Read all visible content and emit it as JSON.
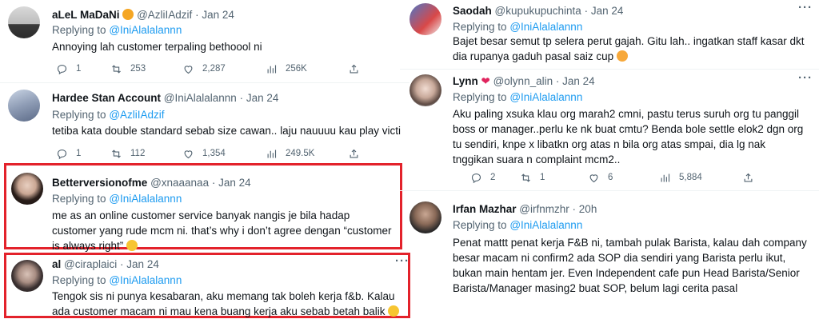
{
  "left": {
    "tweets": [
      {
        "name": "aLeL MaDaNi",
        "handle": "@AzliIAdzif",
        "date": "Jan 24",
        "reply_prefix": "Replying to",
        "reply_to": "@IniAlalalannn",
        "text": "Annoying lah customer terpaling bethoool ni",
        "stats": {
          "replies": "1",
          "retweets": "253",
          "likes": "2,287",
          "views": "256K"
        }
      },
      {
        "name": "Hardee Stan Account",
        "handle": "@IniAlalalannn",
        "date": "Jan 24",
        "reply_prefix": "Replying to",
        "reply_to": "@AzliIAdzif",
        "text": "tetiba kata double standard sebab size cawan.. laju nauuuu kau play victi",
        "stats": {
          "replies": "1",
          "retweets": "112",
          "likes": "1,354",
          "views": "249.5K"
        }
      },
      {
        "name": "Betterversionofme",
        "handle": "@xnaaanaa",
        "date": "Jan 24",
        "reply_prefix": "Replying to",
        "reply_to": "@IniAlalalannn",
        "text": "me as an online customer service banyak nangis je bila hadap customer yang rude mcm ni. that’s why i don’t agree dengan “customer is always right”"
      },
      {
        "name": "al",
        "handle": "@ciraplaici",
        "date": "Jan 24",
        "reply_prefix": "Replying to",
        "reply_to": "@IniAlalalannn",
        "text": "Tengok sis ni punya kesabaran, aku memang tak boleh kerja f&b. Kalau ada customer macam ni mau kena buang kerja aku sebab betah balik"
      }
    ]
  },
  "right": {
    "tweets": [
      {
        "name": "Saodah",
        "handle": "@kupukupuchinta",
        "date": "Jan 24",
        "reply_prefix": "Replying to",
        "reply_to": "@IniAlalalannn",
        "text": "Bajet besar semut tp selera perut gajah. Gitu lah.. ingatkan staff kasar dkt dia rupanya gaduh pasal saiz cup"
      },
      {
        "name": "Lynn",
        "handle": "@olynn_alin",
        "date": "Jan 24",
        "reply_prefix": "Replying to",
        "reply_to": "@IniAlalalannn",
        "text": "Aku paling xsuka klau org marah2 cmni, pastu terus suruh org tu panggil boss or manager..perlu ke nk buat cmtu? Benda bole settle elok2 dgn org tu sendiri, knpe x libatkn org atas n bila org atas smpai, dia lg nak tnggikan suara n complaint mcm2..",
        "stats": {
          "replies": "2",
          "retweets": "1",
          "likes": "6",
          "views": "5,884"
        }
      },
      {
        "name": "Irfan Mazhar",
        "handle": "@irfnmzhr",
        "date": "20h",
        "reply_prefix": "Replying to",
        "reply_to": "@IniAlalalannn",
        "text": "Penat mattt penat kerja F&B ni, tambah pulak Barista, kalau dah company besar macam ni confirm2 ada SOP dia sendiri yang Barista perlu ikut, bukan main hentam jer. Even Independent cafe pun Head Barista/Senior Barista/Manager masing2 buat SOP, belum lagi cerita pasal"
      }
    ]
  },
  "colors": {
    "link": "#1d9bf0",
    "muted": "#536471",
    "highlight": "#e3222b"
  }
}
